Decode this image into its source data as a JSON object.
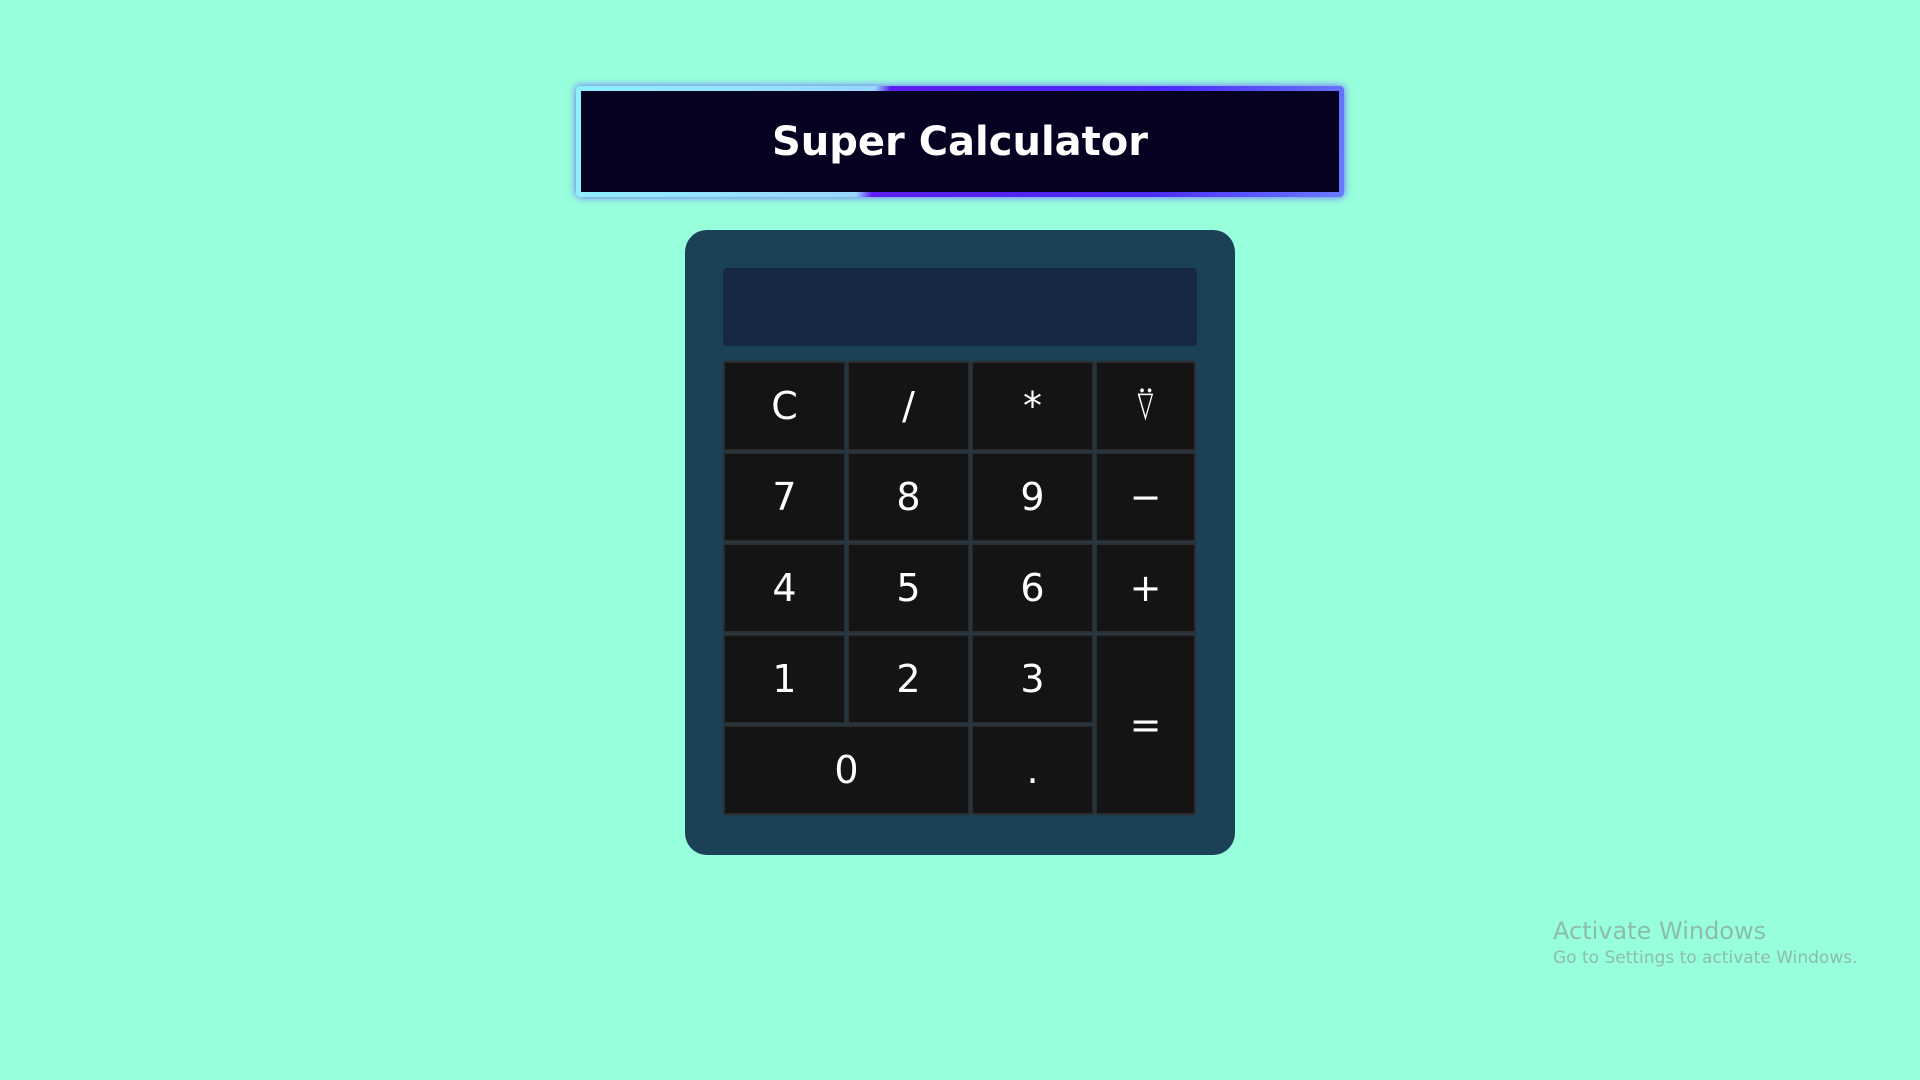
{
  "header": {
    "title": "Super Calculator"
  },
  "calculator": {
    "display_value": "",
    "keys": [
      {
        "label": "C",
        "name": "clear-button"
      },
      {
        "label": "/",
        "name": "divide-button"
      },
      {
        "label": "*",
        "name": "multiply-button"
      },
      {
        "label": "⍢",
        "name": "backspace-button"
      },
      {
        "label": "7",
        "name": "digit-7-button"
      },
      {
        "label": "8",
        "name": "digit-8-button"
      },
      {
        "label": "9",
        "name": "digit-9-button"
      },
      {
        "label": "−",
        "name": "subtract-button"
      },
      {
        "label": "4",
        "name": "digit-4-button"
      },
      {
        "label": "5",
        "name": "digit-5-button"
      },
      {
        "label": "6",
        "name": "digit-6-button"
      },
      {
        "label": "+",
        "name": "add-button"
      },
      {
        "label": "1",
        "name": "digit-1-button"
      },
      {
        "label": "2",
        "name": "digit-2-button"
      },
      {
        "label": "3",
        "name": "digit-3-button"
      },
      {
        "label": "=",
        "name": "equals-button"
      },
      {
        "label": "0",
        "name": "digit-0-button"
      },
      {
        "label": ".",
        "name": "decimal-button"
      }
    ]
  },
  "watermark": {
    "title": "Activate Windows",
    "subtitle": "Go to Settings to activate Windows."
  },
  "colors": {
    "background": "#98ffdc",
    "title_bar": "#050321",
    "calculator_body": "#1a4158",
    "display": "#172942",
    "key": "#141414",
    "accent_gradient_start": "#5c1df0",
    "accent_gradient_end": "#4b2bff"
  }
}
